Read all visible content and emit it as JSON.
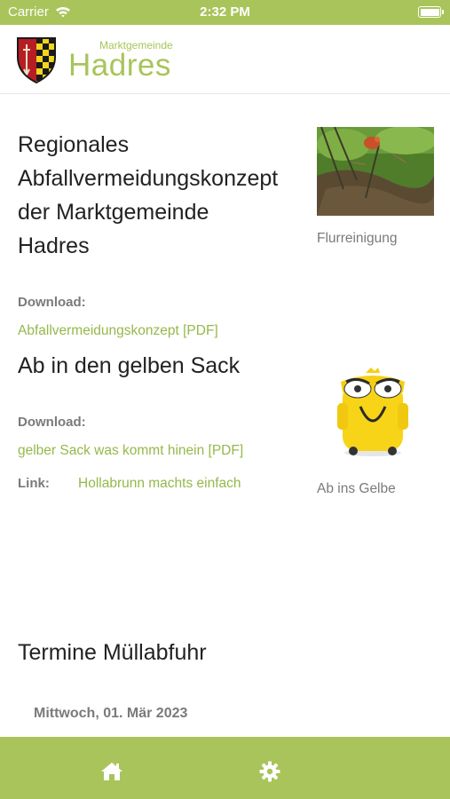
{
  "status_bar": {
    "carrier": "Carrier",
    "time": "2:32 PM"
  },
  "header": {
    "logo_subtitle": "Marktgemeinde",
    "logo_title": "Hadres"
  },
  "sections": {
    "abfall": {
      "title_lines": [
        "Regionales",
        "Abfallvermeidungskonzept",
        "der Marktgemeinde",
        "Hadres"
      ],
      "download_label": "Download:",
      "download_link": "Abfallvermeidungskonzept [PDF]",
      "image_caption": "Flurreinigung"
    },
    "gelber_sack": {
      "title": "Ab in den gelben Sack",
      "download_label": "Download:",
      "download_link": "gelber Sack was kommt hinein [PDF]",
      "link_label": "Link:",
      "link_text": "Hollabrunn machts einfach",
      "image_caption": "Ab ins Gelbe"
    },
    "termine": {
      "title": "Termine Müllabfuhr",
      "first_date": "Mittwoch, 01. Mär 2023"
    }
  },
  "tabbar": {
    "items": [
      {
        "name": "home",
        "icon": "home-icon"
      },
      {
        "name": "settings",
        "icon": "gear-icon"
      }
    ]
  },
  "colors": {
    "accent": "#a9c45a",
    "link": "#95b84a",
    "muted_text": "#7a7a7a",
    "text": "#222222"
  }
}
